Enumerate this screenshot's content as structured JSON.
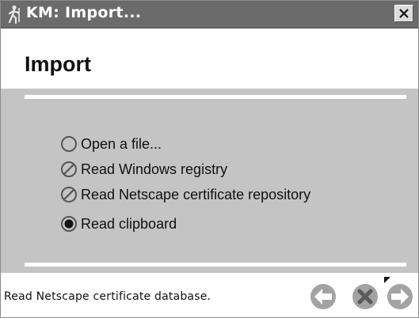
{
  "window": {
    "title": "KM: Import...",
    "icons": {
      "app": "walking-person-icon",
      "close": "close-icon"
    }
  },
  "header": {
    "title": "Import"
  },
  "import_options": [
    {
      "label": "Open a file...",
      "state": "unselected",
      "enabled": true
    },
    {
      "label": "Read Windows registry",
      "state": "disabled",
      "enabled": false
    },
    {
      "label": "Read Netscape certificate repository",
      "state": "disabled",
      "enabled": false
    },
    {
      "label": "Read clipboard",
      "state": "selected",
      "enabled": true
    }
  ],
  "footer": {
    "status": "Read Netscape certificate database.",
    "icons": {
      "back": "back-arrow-icon",
      "cancel": "cancel-x-icon",
      "next": "next-arrow-icon"
    }
  },
  "colors": {
    "titlebar": "#6b6b6b",
    "panel": "#c4c4c4",
    "nav_button": "#a3a3a3"
  }
}
